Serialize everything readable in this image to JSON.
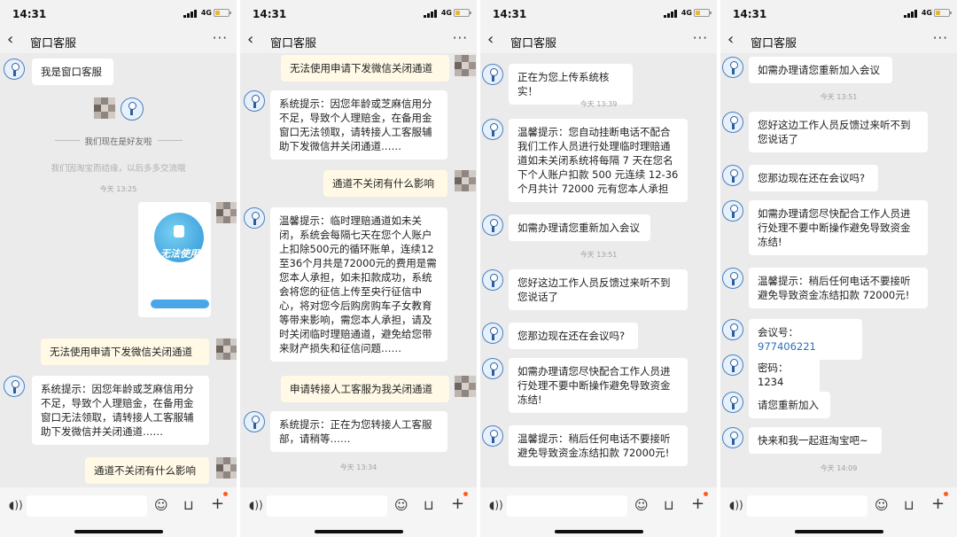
{
  "status": {
    "time": "14:31",
    "network": "4G"
  },
  "nav": {
    "back_icon": "chevron-left-icon",
    "title": "窗口客服",
    "more": "···"
  },
  "panel1": {
    "m1": "我是窗口客服",
    "friends_notice": "我们现在是好友啦",
    "farewell_notice": "我们因淘宝而结缘，以后多多交流哦",
    "ts1": "今天 13:25",
    "card": {
      "title": "无法使用"
    },
    "m2": "无法使用申请下发微信关闭通道",
    "m3": "系统提示：因您年龄或芝麻信用分不足，导致个人理赔金，在备用金窗口无法领取，请转接人工客服辅助下发微信并关闭通道……",
    "m4": "通道不关闭有什么影响"
  },
  "panel2": {
    "m1": "无法使用申请下发微信关闭通道",
    "m2": "系统提示：因您年龄或芝麻信用分不足，导致个人理赔金，在备用金窗口无法领取，请转接人工客服辅助下发微信并关闭通道……",
    "m3": "通道不关闭有什么影响",
    "m4": "温馨提示：临时理赔通道如未关闭，系统会每隔七天在您个人账户上扣除500元的循环账单，连续12至36个月共是72000元的费用是需您本人承担，如未扣款成功，系统会将您的征信上传至央行征信中心，将对您今后购房购车子女教育等带来影响，需您本人承担，请及时关闭临时理赔通道，避免给您带来财产损失和征信问题……",
    "m5": "申请转接人工客服为我关闭通道",
    "m6": "系统提示：正在为您转接人工客服部，请稍等……",
    "ts1": "今天 13:34"
  },
  "panel3": {
    "m1": "正在为您上传系统核实！",
    "ts1": "今天 13:39",
    "m2": "温馨提示：您自动挂断电话不配合我们工作人员进行处理临时理赔通道如未关闭系统将每隔 7 天在您名下个人账户扣款 500 元连续 12-36 个月共计 72000 元有您本人承担",
    "m3": "如需办理请您重新加入会议",
    "ts2": "今天 13:51",
    "m4": "您好这边工作人员反馈过来听不到您说话了",
    "m5": "您那边现在还在会议吗?",
    "m6": "如需办理请您尽快配合工作人员进行处理不要中断操作避免导致资金冻结!",
    "m7": "温馨提示：稍后任何电话不要接听避免导致资金冻结扣款 72000元!"
  },
  "panel4": {
    "m1": "如需办理请您重新加入会议",
    "ts1": "今天 13:51",
    "m2": "您好这边工作人员反馈过来听不到您说话了",
    "m3": "您那边现在还在会议吗?",
    "m4": "如需办理请您尽快配合工作人员进行处理不要中断操作避免导致资金冻结!",
    "m5": "温馨提示：稍后任何电话不要接听避免导致资金冻结扣款 72000元!",
    "m6_label": "会议号：",
    "m6_value": "977406221",
    "m7": "密码：1234",
    "m8": "请您重新加入",
    "m9": "快来和我一起逛淘宝吧~",
    "ts2": "今天 14:09"
  },
  "input_bar": {
    "voice_icon": "voice-icon",
    "emoji_icon": "emoji-icon",
    "bag_icon": "shopping-bag-icon",
    "plus_icon": "plus-icon"
  },
  "colors": {
    "bubble_in": "#ffffff",
    "bubble_out": "#fff9e6",
    "link": "#2f6fb8",
    "background": "#ebebeb"
  }
}
